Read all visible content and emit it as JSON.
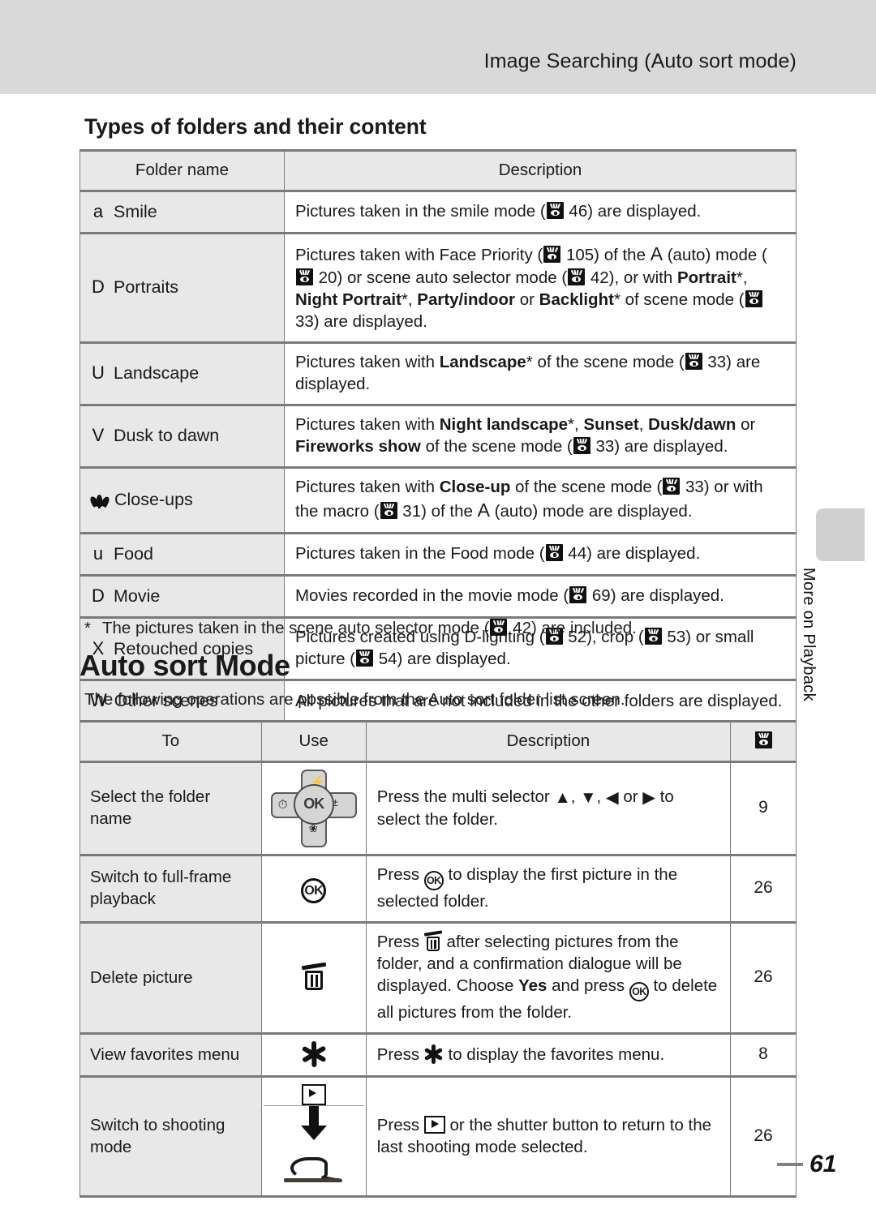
{
  "header": {
    "running_title": "Image Searching (Auto sort mode)",
    "side_tab_label": "More on Playback"
  },
  "page_number": "61",
  "section_folders": {
    "heading": "Types of folders and their content",
    "columns": [
      "Folder name",
      "Description"
    ],
    "rows": [
      {
        "glyph": "a",
        "glyph_name": "smile-icon",
        "name": "Smile",
        "desc_parts": [
          {
            "t": "Pictures taken in the smile mode ("
          },
          {
            "ref": "46"
          },
          {
            "t": ") are displayed."
          }
        ]
      },
      {
        "glyph": "D",
        "glyph_name": "portrait-icon",
        "name": "Portraits",
        "desc_parts": [
          {
            "t": "Pictures taken with Face Priority ("
          },
          {
            "ref": "105"
          },
          {
            "t": ") of the "
          },
          {
            "mode": "A"
          },
          {
            "t": " (auto) mode ("
          },
          {
            "ref": "20"
          },
          {
            "t": ") or scene auto selector mode ("
          },
          {
            "ref": "42"
          },
          {
            "t": "), or with "
          },
          {
            "b": "Portrait"
          },
          {
            "t": "*, "
          },
          {
            "b": "Night Portrait"
          },
          {
            "t": "*, "
          },
          {
            "b": "Party/indoor"
          },
          {
            "t": " or "
          },
          {
            "b": "Backlight"
          },
          {
            "t": "* of scene mode ("
          },
          {
            "ref": "33"
          },
          {
            "t": ") are displayed."
          }
        ]
      },
      {
        "glyph": "U",
        "glyph_name": "landscape-icon",
        "name": "Landscape",
        "desc_parts": [
          {
            "t": "Pictures taken with "
          },
          {
            "b": "Landscape"
          },
          {
            "t": "* of the scene mode ("
          },
          {
            "ref": "33"
          },
          {
            "t": ") are displayed."
          }
        ]
      },
      {
        "glyph": "V",
        "glyph_name": "dusk-to-dawn-icon",
        "name": "Dusk to dawn",
        "desc_parts": [
          {
            "t": "Pictures taken with "
          },
          {
            "b": "Night landscape"
          },
          {
            "t": "*, "
          },
          {
            "b": "Sunset"
          },
          {
            "t": ", "
          },
          {
            "b": "Dusk/dawn"
          },
          {
            "t": " or "
          },
          {
            "b": "Fireworks show"
          },
          {
            "t": " of the scene mode ("
          },
          {
            "ref": "33"
          },
          {
            "t": ") are displayed."
          }
        ]
      },
      {
        "glyph": "tulip",
        "glyph_name": "macro-flower-icon",
        "name": "Close-ups",
        "desc_parts": [
          {
            "t": "Pictures taken with "
          },
          {
            "b": "Close-up"
          },
          {
            "t": " of the scene mode ("
          },
          {
            "ref": "33"
          },
          {
            "t": ") or with the macro ("
          },
          {
            "ref": "31"
          },
          {
            "t": ") of the "
          },
          {
            "mode": "A"
          },
          {
            "t": " (auto) mode are displayed."
          }
        ]
      },
      {
        "glyph": "u",
        "glyph_name": "food-icon",
        "name": "Food",
        "desc_parts": [
          {
            "t": "Pictures taken in the Food mode ("
          },
          {
            "ref": "44"
          },
          {
            "t": ") are displayed."
          }
        ]
      },
      {
        "glyph": "D",
        "glyph_name": "movie-icon",
        "name": "Movie",
        "desc_parts": [
          {
            "t": "Movies recorded in the movie mode ("
          },
          {
            "ref": "69"
          },
          {
            "t": ") are displayed."
          }
        ]
      },
      {
        "glyph": "X",
        "glyph_name": "retouched-copies-icon",
        "name": "Retouched copies",
        "desc_parts": [
          {
            "t": "Pictures created using D-lighting ("
          },
          {
            "ref": "52"
          },
          {
            "t": "), crop ("
          },
          {
            "ref": "53"
          },
          {
            "t": ") or small picture ("
          },
          {
            "ref": "54"
          },
          {
            "t": ") are displayed."
          }
        ]
      },
      {
        "glyph": "W",
        "glyph_name": "other-scenes-icon",
        "name": "Other scenes",
        "desc_parts": [
          {
            "t": "All pictures that are not included in the other folders are displayed."
          }
        ]
      }
    ],
    "footnote_parts": [
      {
        "t": "The pictures taken in the scene auto selector mode ("
      },
      {
        "ref": "42"
      },
      {
        "t": ") are included."
      }
    ]
  },
  "section_auto_sort": {
    "heading": "Auto sort Mode",
    "intro": "The following operations are possible from the Auto sort folder list screen.",
    "columns": [
      "To",
      "Use",
      "Description",
      "ref-icon"
    ],
    "rows": [
      {
        "to": "Select the folder name",
        "use_icon": "multi-selector-icon",
        "desc_parts": [
          {
            "t": "Press the multi selector "
          },
          {
            "tri": "up"
          },
          {
            "t": ", "
          },
          {
            "tri": "down"
          },
          {
            "t": ", "
          },
          {
            "tri": "left"
          },
          {
            "t": " or "
          },
          {
            "tri": "right"
          },
          {
            "t": " to select the folder."
          }
        ],
        "page": "9"
      },
      {
        "to": "Switch to full-frame playback",
        "use_icon": "ok-button-icon",
        "desc_parts": [
          {
            "t": "Press "
          },
          {
            "ok": true
          },
          {
            "t": " to display the first picture in the selected folder."
          }
        ],
        "page": "26"
      },
      {
        "to": "Delete picture",
        "use_icon": "trash-icon",
        "desc_parts": [
          {
            "t": "Press "
          },
          {
            "trash": true
          },
          {
            "t": " after selecting pictures from the folder, and a confirmation dialogue will be displayed. Choose "
          },
          {
            "b": "Yes"
          },
          {
            "t": " and press "
          },
          {
            "ok": true
          },
          {
            "t": " to delete all pictures from the folder."
          }
        ],
        "page": "26"
      },
      {
        "to": "View favorites menu",
        "use_icon": "favorites-flower-icon",
        "desc_parts": [
          {
            "t": "Press "
          },
          {
            "flower": true
          },
          {
            "t": " to display the favorites menu."
          }
        ],
        "page": "8"
      },
      {
        "to": "Switch to shooting mode",
        "use_icon": "playback-and-shutter-icon",
        "desc_parts": [
          {
            "t": "Press "
          },
          {
            "play": true
          },
          {
            "t": " or the shutter button to return to the last shooting mode selected."
          }
        ],
        "page": "26"
      }
    ]
  },
  "multi_selector": {
    "ok_label": "OK",
    "flash_icon": "flash-icon",
    "self_timer_icon": "self-timer-icon",
    "exposure_icon": "exposure-compensation-icon",
    "macro_icon": "macro-icon"
  },
  "colors": {
    "header_band": "#d9d9d9",
    "table_header_fill": "#e8e8e8",
    "name_cell_fill": "#e8e8e8",
    "rule": "#7a7a7a",
    "side_tab": "#cfcfcf"
  }
}
